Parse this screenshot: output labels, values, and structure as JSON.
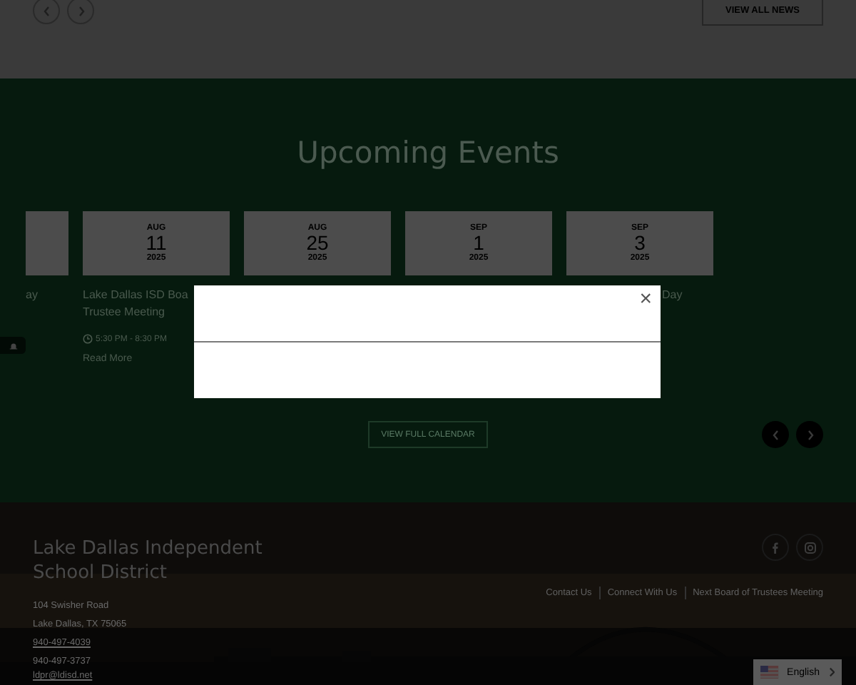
{
  "news": {
    "button": "VIEW ALL NEWS"
  },
  "events": {
    "title": "Upcoming Events",
    "items": [
      {
        "kind": "partial",
        "title": "ay"
      },
      {
        "kind": "full",
        "month": "AUG",
        "day": "11",
        "year": "2025",
        "title": "Lake Dallas ISD Boa",
        "title_2": "Trustee Meeting",
        "time": "5:30 PM - 8:30 PM",
        "link": "Read More"
      },
      {
        "kind": "full",
        "month": "AUG",
        "day": "25",
        "year": "2025"
      },
      {
        "kind": "full",
        "month": "SEP",
        "day": "1",
        "year": "2025"
      },
      {
        "kind": "full",
        "month": "SEP",
        "day": "3",
        "year": "2025",
        "title": "Day"
      }
    ],
    "button": "VIEW FULL CALENDAR"
  },
  "footer": {
    "name": "Lake Dallas Independent School District",
    "address": [
      "104 Swisher Road",
      "Lake Dallas, TX  75065"
    ],
    "phones": [
      {
        "text": "940-497-4039",
        "link": true
      },
      {
        "text": "940-497-3737",
        "link": false
      }
    ],
    "email": "ldpr@ldisd.net",
    "links": [
      "Contact Us",
      "Connect With Us",
      "Next Board of Trustees Meeting"
    ],
    "language": "English"
  },
  "modal": {
    "close": "×"
  }
}
